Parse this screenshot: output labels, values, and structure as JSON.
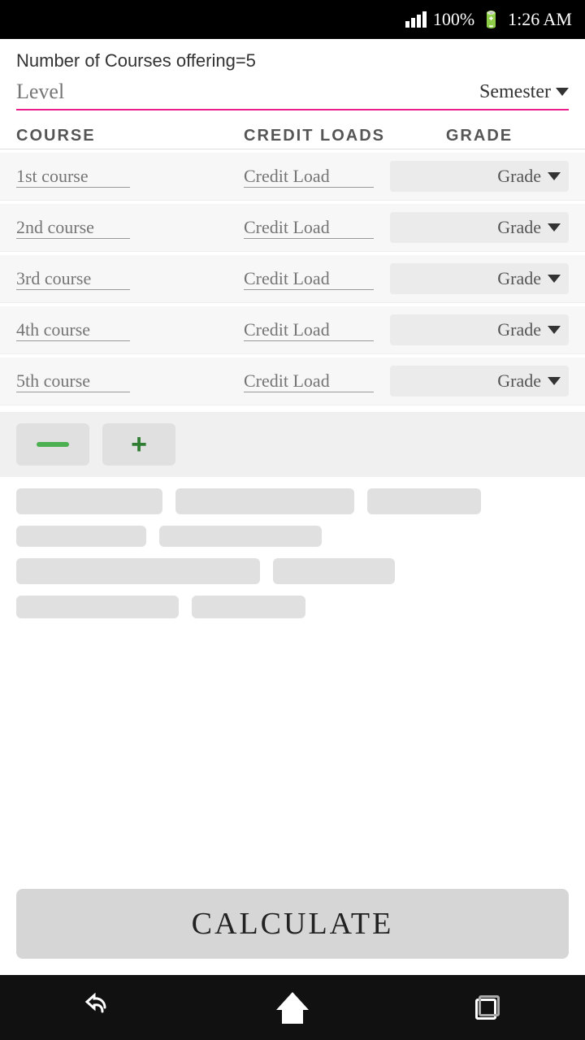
{
  "statusBar": {
    "battery": "100%",
    "time": "1:26 AM"
  },
  "header": {
    "numCourses": "Number of Courses offering=5",
    "levelPlaceholder": "Level",
    "semesterLabel": "Semester"
  },
  "tableHeaders": {
    "course": "COURSE",
    "creditLoads": "CREDIT LOADS",
    "grade": "GRADE"
  },
  "courses": [
    {
      "label": "1st course",
      "creditLoad": "Credit Load",
      "grade": "Grade"
    },
    {
      "label": "2nd course",
      "creditLoad": "Credit Load",
      "grade": "Grade"
    },
    {
      "label": "3rd course",
      "creditLoad": "Credit Load",
      "grade": "Grade"
    },
    {
      "label": "4th course",
      "creditLoad": "Credit Load",
      "grade": "Grade"
    },
    {
      "label": "5th course",
      "creditLoad": "Credit Load",
      "grade": "Grade"
    }
  ],
  "controls": {
    "minusLabel": "−",
    "plusLabel": "+"
  },
  "calculateBtn": "CALCULATE",
  "nav": {
    "back": "back",
    "home": "home",
    "recents": "recents"
  }
}
